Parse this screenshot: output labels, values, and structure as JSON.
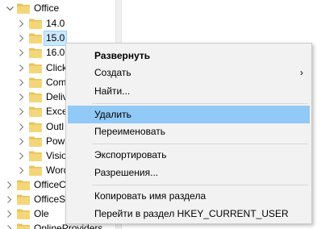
{
  "tree": {
    "items": [
      {
        "label": "Office",
        "expanded": true,
        "selected": false
      },
      {
        "label": "14.0",
        "expanded": false,
        "selected": false
      },
      {
        "label": "15.0",
        "expanded": false,
        "selected": true
      },
      {
        "label": "16.0",
        "expanded": false,
        "selected": false
      },
      {
        "label": "Click",
        "expanded": false,
        "selected": false
      },
      {
        "label": "Com",
        "expanded": false,
        "selected": false
      },
      {
        "label": "Deliv",
        "expanded": false,
        "selected": false
      },
      {
        "label": "Exce",
        "expanded": false,
        "selected": false
      },
      {
        "label": "Outl",
        "expanded": false,
        "selected": false
      },
      {
        "label": "Pow",
        "expanded": false,
        "selected": false
      },
      {
        "label": "Visio",
        "expanded": false,
        "selected": false
      },
      {
        "label": "Word",
        "expanded": false,
        "selected": false
      },
      {
        "label": "OfficeC",
        "expanded": false,
        "selected": false
      },
      {
        "label": "OfficeSo",
        "expanded": false,
        "selected": false
      },
      {
        "label": "Ole",
        "expanded": false,
        "selected": false
      },
      {
        "label": "OnlineProviders",
        "expanded": false,
        "selected": false
      }
    ]
  },
  "menu": {
    "expand": "Развернуть",
    "create": "Создать",
    "find": "Найти...",
    "delete": "Удалить",
    "rename": "Переименовать",
    "export": "Экспортировать",
    "permissions": "Разрешения...",
    "copy_key_name": "Копировать имя раздела",
    "goto_hkcu": "Перейти в раздел HKEY_CURRENT_USER",
    "submenu_arrow": "›"
  },
  "colors": {
    "highlight": "#91c9f7",
    "selection": "#cce8ff",
    "folder": "#e8c25a"
  }
}
